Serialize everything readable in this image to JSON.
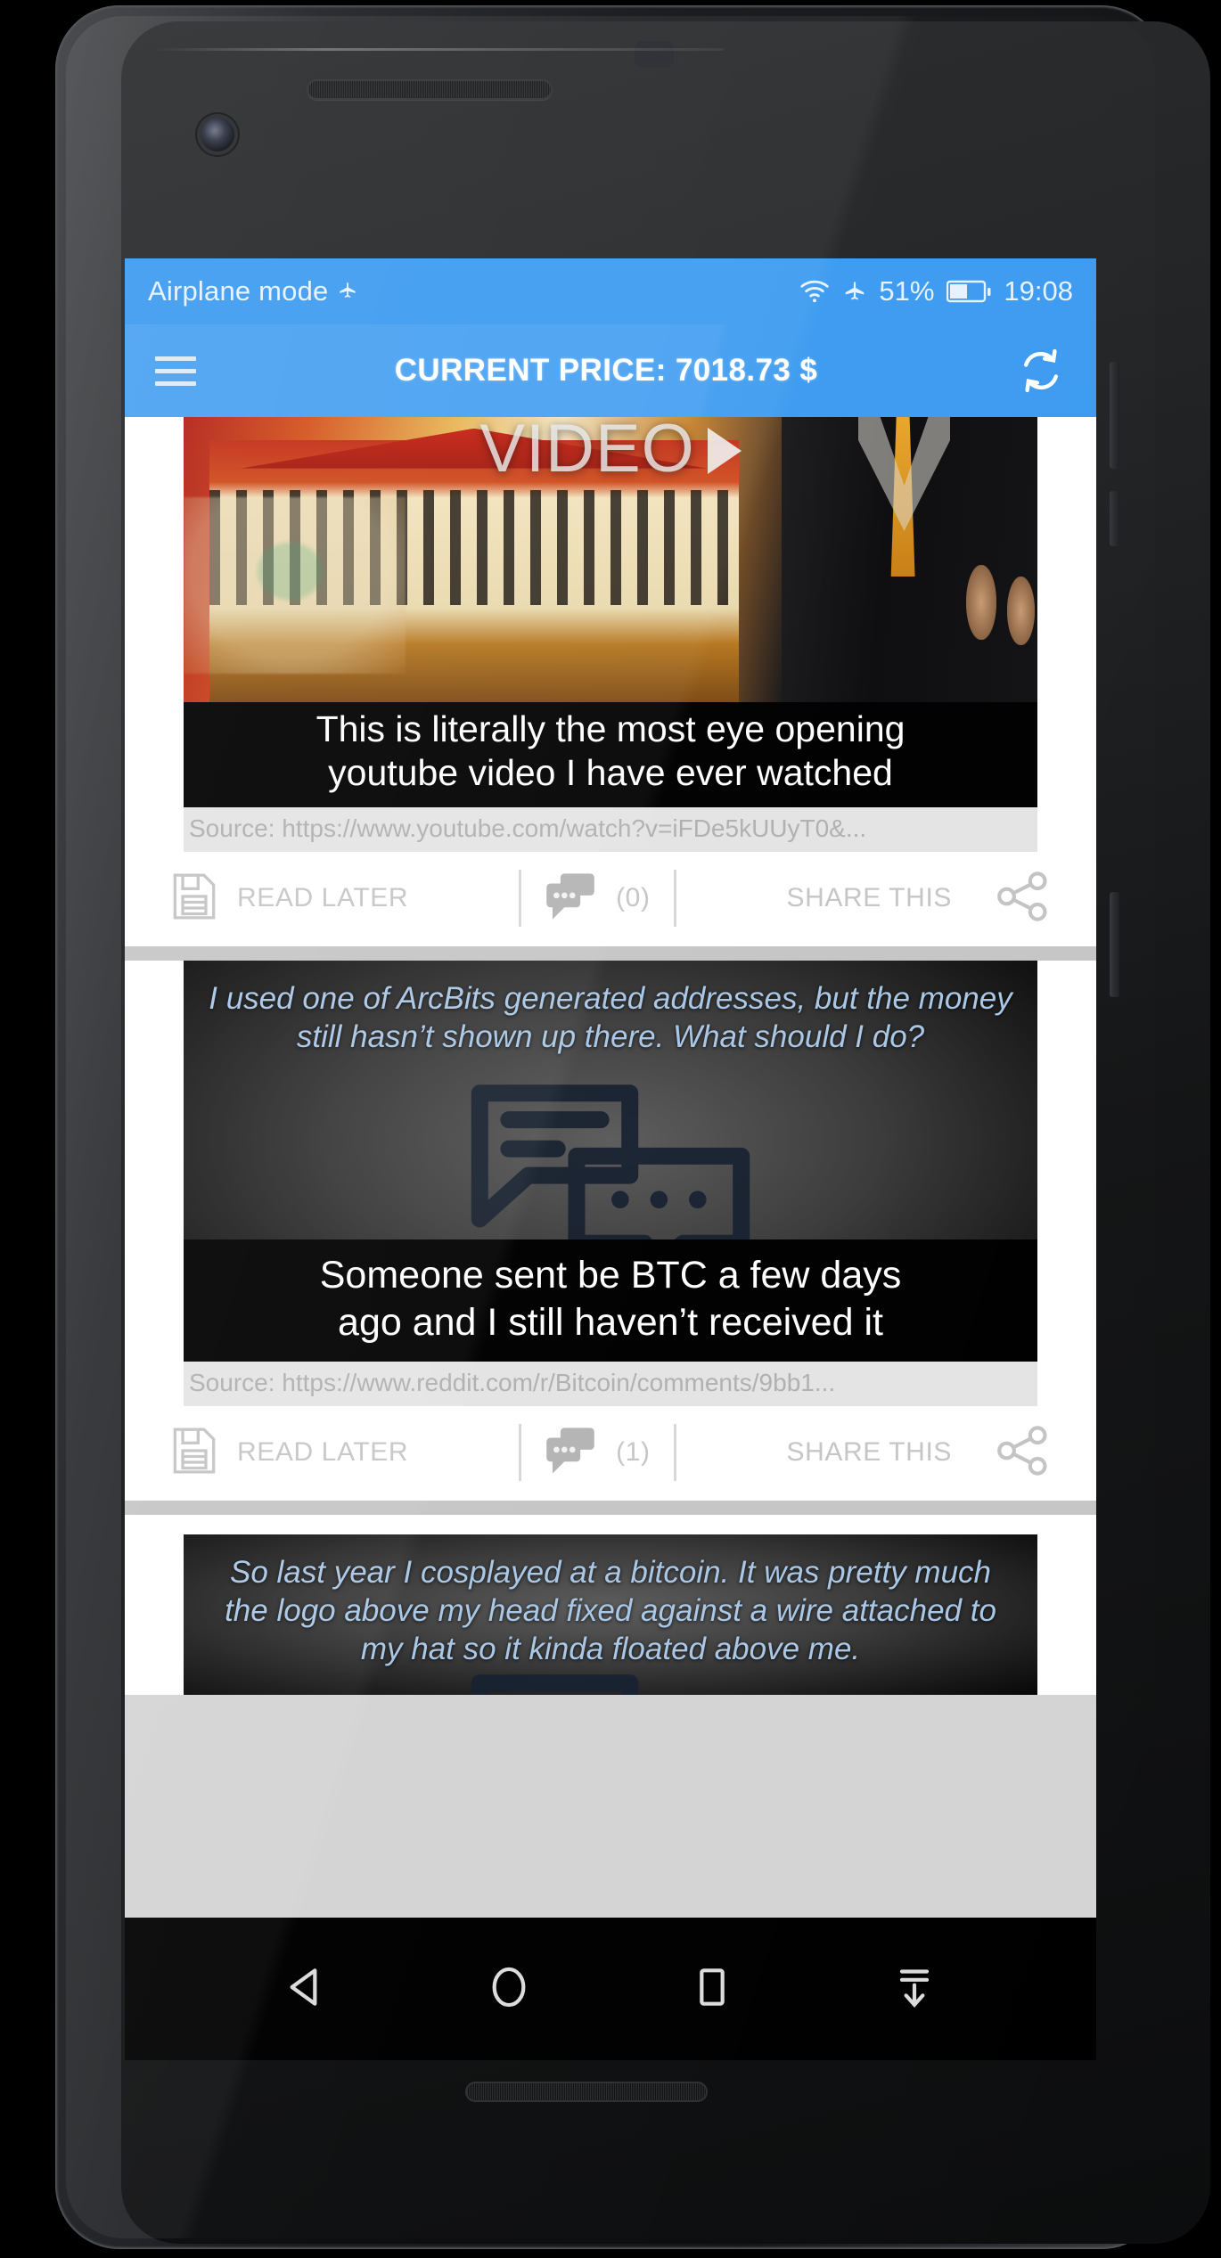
{
  "status_bar": {
    "airplane_text": "Airplane mode",
    "airplane_glyph": "airplane-icon",
    "wifi_icon": "wifi-icon",
    "flight_icon": "airplane-mode-icon",
    "battery_percent": "51%",
    "battery_icon": "battery-icon",
    "clock": "19:08"
  },
  "app_bar": {
    "menu_icon": "hamburger-menu-icon",
    "title": "CURRENT PRICE: 7018.73 $",
    "refresh_icon": "refresh-icon",
    "background_color": "#3d9bf0"
  },
  "feed": {
    "cards": [
      {
        "type": "video",
        "video_label": "VIDEO",
        "play_icon": "play-triangle-icon",
        "headline_line1": "This is literally the most eye opening",
        "headline_line2": "youtube video I have ever watched",
        "source": "Source: https://www.youtube.com/watch?v=iFDe5kUUyT0&...",
        "actions": {
          "save_icon": "floppy-disk-icon",
          "read_later_label": "READ LATER",
          "comment_icon": "comment-bubbles-icon",
          "comment_count": "(0)",
          "share_label": "SHARE THIS",
          "share_icon": "share-nodes-icon"
        }
      },
      {
        "type": "quote",
        "excerpt": "I used one of ArcBits generated addresses, but the money still hasn’t shown up there. What should I do?",
        "watermark_icon": "chat-bubbles-watermark-icon",
        "headline_line1": "Someone sent be BTC a few days",
        "headline_line2": "ago and I still haven’t received it",
        "source": "Source: https://www.reddit.com/r/Bitcoin/comments/9bb1...",
        "actions": {
          "save_icon": "floppy-disk-icon",
          "read_later_label": "READ LATER",
          "comment_icon": "comment-bubbles-icon",
          "comment_count": "(1)",
          "share_label": "SHARE THIS",
          "share_icon": "share-nodes-icon"
        }
      },
      {
        "type": "quote",
        "excerpt": "So last year I cosplayed at a bitcoin. It was pretty much the logo above my head fixed against a wire attached to my hat so it kinda floated above me.",
        "watermark_icon": "chat-bubbles-watermark-icon"
      }
    ]
  },
  "nav_bar": {
    "back_icon": "back-triangle-icon",
    "home_icon": "home-circle-icon",
    "recents_icon": "recents-square-icon",
    "hide_keyboard_icon": "hide-keyboard-down-arrow-icon"
  },
  "colors": {
    "accent": "#3d9bf0",
    "card_bg": "#ffffff",
    "source_bg": "#e4e4e4",
    "quote_text": "#a9c7e6"
  }
}
